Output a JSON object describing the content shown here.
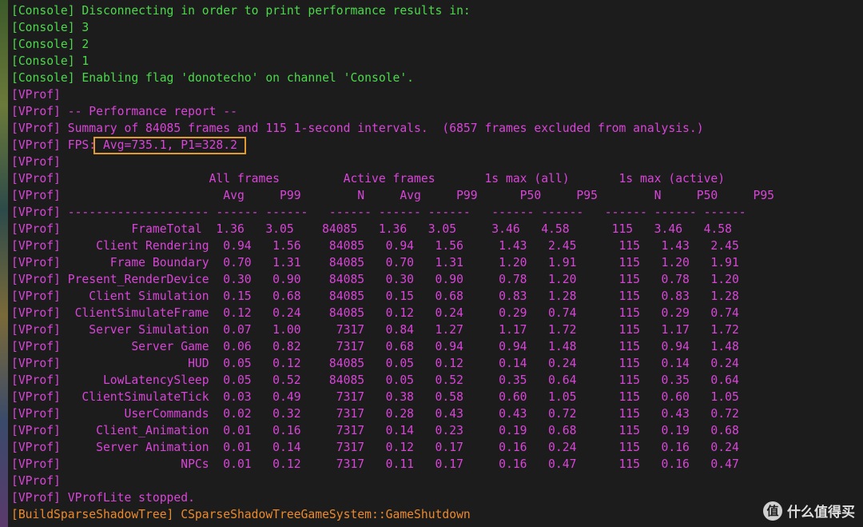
{
  "terminal": {
    "lines": [
      {
        "channel": "console",
        "text": "[Console] Disconnecting in order to print performance results in:"
      },
      {
        "channel": "console",
        "text": "[Console] 3"
      },
      {
        "channel": "console",
        "text": "[Console] 2"
      },
      {
        "channel": "console",
        "text": "[Console] 1"
      },
      {
        "channel": "console",
        "text": "[Console] Enabling flag 'donotecho' on channel 'Console'."
      },
      {
        "channel": "vprof",
        "text": "[VProf]"
      },
      {
        "channel": "vprof",
        "text": "[VProf] -- Performance report --"
      },
      {
        "channel": "vprof",
        "text": "[VProf] Summary of 84085 frames and 115 1-second intervals.  (6857 frames excluded from analysis.)"
      },
      {
        "channel": "vprof",
        "text": "[VProf] FPS: Avg=735.1, P1=328.2"
      },
      {
        "channel": "vprof",
        "text": "[VProf]"
      },
      {
        "channel": "vprof",
        "text": "[VProf]                     All frames         Active frames       1s max (all)       1s max (active)"
      },
      {
        "channel": "vprof",
        "text": "[VProf]                       Avg     P99        N     Avg     P99      P50     P95        N     P50     P95"
      },
      {
        "channel": "vprof",
        "text": "[VProf] -------------------- ------ ------   ------ ------ ------   ------ ------   ------ ------ ------"
      },
      {
        "channel": "vprof",
        "text": "[VProf]          FrameTotal  1.36   3.05    84085   1.36   3.05     3.46   4.58      115   3.46   4.58"
      },
      {
        "channel": "vprof",
        "text": "[VProf]     Client Rendering  0.94   1.56    84085   0.94   1.56     1.43   2.45      115   1.43   2.45"
      },
      {
        "channel": "vprof",
        "text": "[VProf]       Frame Boundary  0.70   1.31    84085   0.70   1.31     1.20   1.91      115   1.20   1.91"
      },
      {
        "channel": "vprof",
        "text": "[VProf] Present_RenderDevice  0.30   0.90    84085   0.30   0.90     0.78   1.20      115   0.78   1.20"
      },
      {
        "channel": "vprof",
        "text": "[VProf]    Client Simulation  0.15   0.68    84085   0.15   0.68     0.83   1.28      115   0.83   1.28"
      },
      {
        "channel": "vprof",
        "text": "[VProf]  ClientSimulateFrame  0.12   0.24    84085   0.12   0.24     0.29   0.74      115   0.29   0.74"
      },
      {
        "channel": "vprof",
        "text": "[VProf]    Server Simulation  0.07   1.00     7317   0.84   1.27     1.17   1.72      115   1.17   1.72"
      },
      {
        "channel": "vprof",
        "text": "[VProf]          Server Game  0.06   0.82     7317   0.68   0.94     0.94   1.48      115   0.94   1.48"
      },
      {
        "channel": "vprof",
        "text": "[VProf]                  HUD  0.05   0.12    84085   0.05   0.12     0.14   0.24      115   0.14   0.24"
      },
      {
        "channel": "vprof",
        "text": "[VProf]      LowLatencySleep  0.05   0.52    84085   0.05   0.52     0.35   0.64      115   0.35   0.64"
      },
      {
        "channel": "vprof",
        "text": "[VProf]   ClientSimulateTick  0.03   0.49     7317   0.38   0.58     0.60   1.05      115   0.60   1.05"
      },
      {
        "channel": "vprof",
        "text": "[VProf]         UserCommands  0.02   0.32     7317   0.28   0.43     0.43   0.72      115   0.43   0.72"
      },
      {
        "channel": "vprof",
        "text": "[VProf]     Client_Animation  0.01   0.16     7317   0.14   0.23     0.19   0.68      115   0.19   0.68"
      },
      {
        "channel": "vprof",
        "text": "[VProf]     Server Animation  0.01   0.14     7317   0.12   0.17     0.16   0.24      115   0.16   0.24"
      },
      {
        "channel": "vprof",
        "text": "[VProf]                 NPCs  0.01   0.12     7317   0.11   0.17     0.16   0.47      115   0.16   0.47"
      },
      {
        "channel": "vprof",
        "text": "[VProf]"
      },
      {
        "channel": "vprof",
        "text": "[VProf] VProfLite stopped."
      },
      {
        "channel": "build",
        "text": "[BuildSparseShadowTree] CSparseShadowTreeGameSystem::GameShutdown"
      }
    ]
  },
  "colors": {
    "background": "#1c1c1c",
    "console": "#4cd94c",
    "vprof": "#d845d8",
    "build": "#ec8a2b",
    "highlight": "#e29a2c"
  },
  "watermark": {
    "logo_glyph": "值",
    "text": "什么值得买"
  }
}
